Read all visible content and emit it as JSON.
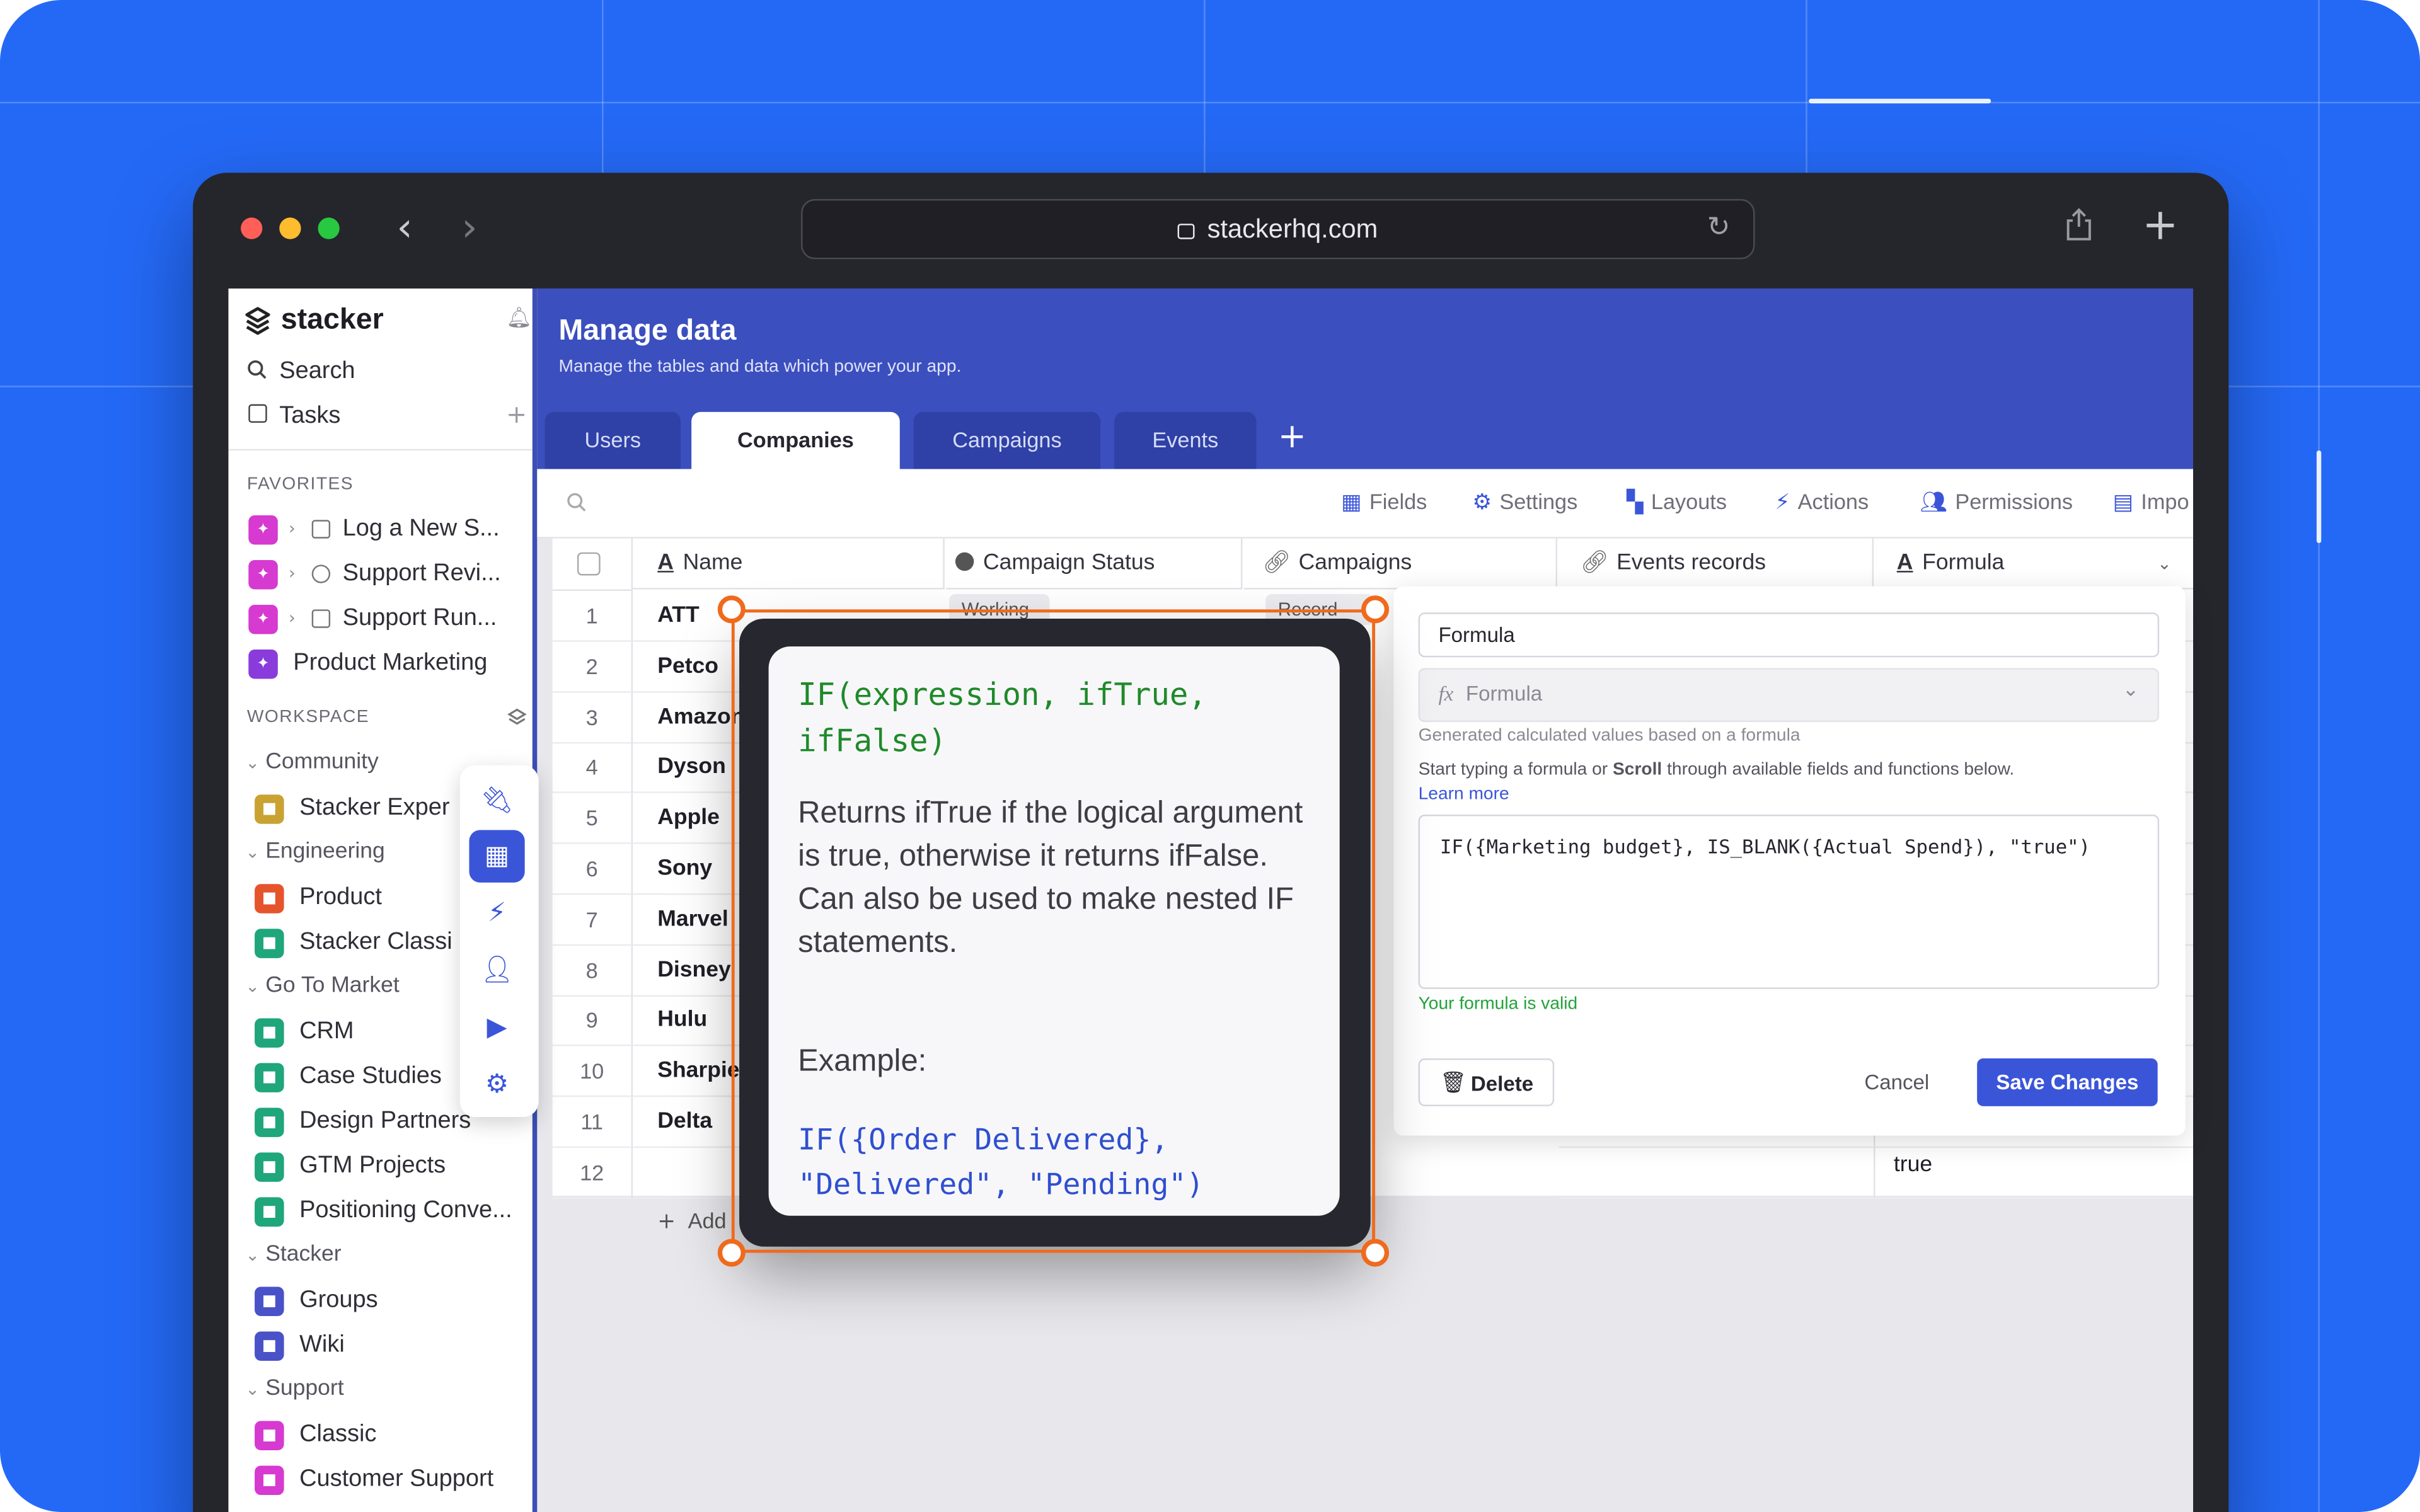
{
  "browser": {
    "url": "stackerhq.com"
  },
  "sidebar": {
    "brand": "stacker",
    "search": "Search",
    "tasks": "Tasks",
    "favorites_title": "FAVORITES",
    "favorites": [
      {
        "label": "Log a New S...",
        "color": "#d63ad0"
      },
      {
        "label": "Support Revi...",
        "color": "#d63ad0"
      },
      {
        "label": "Support Run...",
        "color": "#d63ad0"
      },
      {
        "label": "Product Marketing",
        "color": "#8a3bdb"
      }
    ],
    "workspace_title": "WORKSPACE",
    "groups": [
      {
        "label": "Community",
        "items": [
          {
            "label": "Stacker Exper",
            "color": "#c9a232"
          }
        ]
      },
      {
        "label": "Engineering",
        "items": [
          {
            "label": "Product",
            "color": "#e6542b"
          },
          {
            "label": "Stacker Classi",
            "color": "#1fa67a"
          }
        ]
      },
      {
        "label": "Go To Market",
        "items": [
          {
            "label": "CRM",
            "color": "#1fa67a"
          },
          {
            "label": "Case Studies",
            "color": "#1fa67a"
          },
          {
            "label": "Design Partners",
            "color": "#1fa67a"
          },
          {
            "label": "GTM Projects",
            "color": "#1fa67a"
          },
          {
            "label": "Positioning Conve...",
            "color": "#1fa67a"
          }
        ]
      },
      {
        "label": "Stacker",
        "items": [
          {
            "label": "Groups",
            "color": "#4a52c8"
          },
          {
            "label": "Wiki",
            "color": "#4a52c8"
          }
        ]
      },
      {
        "label": "Support",
        "items": [
          {
            "label": "Classic",
            "color": "#d63ad0"
          },
          {
            "label": "Customer Support",
            "color": "#d63ad0"
          }
        ]
      }
    ]
  },
  "main": {
    "title": "Manage data",
    "subtitle": "Manage the tables and data which power your app.",
    "tabs": [
      "Users",
      "Companies",
      "Campaigns",
      "Events"
    ],
    "active_tab": "Companies",
    "toolbar": [
      "Fields",
      "Settings",
      "Layouts",
      "Actions",
      "Permissions",
      "Impo"
    ],
    "columns": [
      "Name",
      "Campaign Status",
      "Campaigns",
      "Events records",
      "Formula"
    ],
    "rows": [
      {
        "num": "1",
        "name": "ATT"
      },
      {
        "num": "2",
        "name": "Petco"
      },
      {
        "num": "3",
        "name": "Amazon"
      },
      {
        "num": "4",
        "name": "Dyson"
      },
      {
        "num": "5",
        "name": "Apple"
      },
      {
        "num": "6",
        "name": "Sony"
      },
      {
        "num": "7",
        "name": "Marvel"
      },
      {
        "num": "8",
        "name": "Disney"
      },
      {
        "num": "9",
        "name": "Hulu"
      },
      {
        "num": "10",
        "name": "Sharpie"
      },
      {
        "num": "11",
        "name": "Delta"
      },
      {
        "num": "12",
        "name": ""
      }
    ],
    "peek_status": "Working",
    "peek_campaign": "Record",
    "row12_formula": "true",
    "add_row": "Add"
  },
  "panel": {
    "field_name": "Formula",
    "field_type": "Formula",
    "type_hint": "Generated calculated values based on a formula",
    "instructions_pre": "Start typing a formula or ",
    "instructions_bold": "Scroll",
    "instructions_post": " through available fields and functions below.",
    "learn_more": "Learn more",
    "formula": "IF({Marketing budget}, IS_BLANK({Actual Spend}), \"true\")",
    "valid_msg": "Your formula is valid",
    "delete_label": "Delete",
    "cancel_label": "Cancel",
    "save_label": "Save Changes"
  },
  "tooltip": {
    "signature": "IF(expression, ifTrue, ifFalse)",
    "description": "Returns ifTrue if the logical argument is true, otherwise it returns ifFalse. Can also be used to make nested IF statements.",
    "example_label": "Example:",
    "example_code": "IF({Order Delivered}, \"Delivered\", \"Pending\")"
  },
  "colors": {
    "background": "#2469f6",
    "header": "#3b4fbe",
    "accent": "#3b55d9",
    "selection": "#f06a1d",
    "valid": "#22a33a",
    "code_green": "#1f8a2a",
    "code_blue": "#2f4fd0"
  }
}
